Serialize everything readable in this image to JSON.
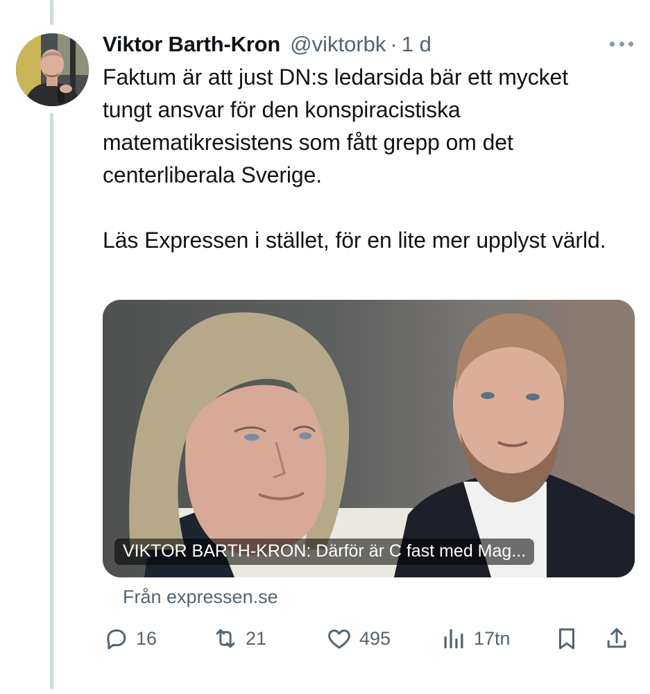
{
  "tweet": {
    "author": {
      "display_name": "Viktor Barth-Kron",
      "handle": "@viktorbk",
      "separator": "·",
      "time": "1 d"
    },
    "paragraphs": [
      "Faktum är att just DN:s ledarsida bär ett mycket tungt ansvar för den konspiracistiska matematikresistens som fått grepp om det centerliberala Sverige.",
      "Läs Expressen i stället, för en lite mer upplyst värld."
    ],
    "card": {
      "title": "VIKTOR BARTH-KRON: Därför är C fast med Mag...",
      "source": "Från expressen.se"
    },
    "actions": {
      "replies": "16",
      "retweets": "21",
      "likes": "495",
      "views": "17tn"
    }
  },
  "icons": {
    "more": "more-options-icon",
    "reply": "reply-icon",
    "retweet": "retweet-icon",
    "like": "heart-icon",
    "views": "views-icon",
    "bookmark": "bookmark-icon",
    "share": "share-icon"
  },
  "colors": {
    "text": "#0f1419",
    "secondary": "#536471",
    "thread_line": "#cfd9de"
  }
}
